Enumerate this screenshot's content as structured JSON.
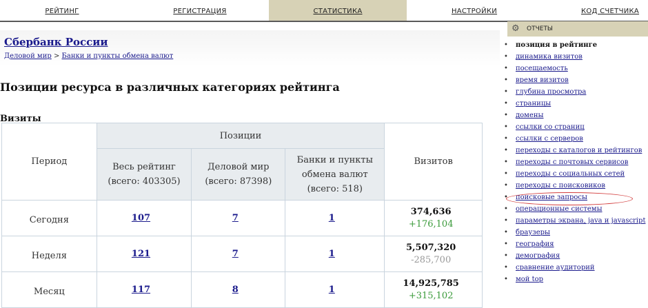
{
  "nav": {
    "tabs": [
      "РЕЙТИНГ",
      "РЕГИСТРАЦИЯ",
      "СТАТИСТИКА",
      "НАСТРОЙКИ",
      "КОД СЧЕТЧИКА"
    ],
    "active": "СТАТИСТИКА"
  },
  "site": {
    "title": "Сбербанк России",
    "breadcrumb": [
      "Деловой мир",
      "Банки и пункты обмена валют"
    ],
    "breadcrumb_sep": " > "
  },
  "page": {
    "heading": "Позиции ресурса в различных категориях рейтинга",
    "section": "Визиты"
  },
  "table": {
    "headers": {
      "period": "Период",
      "positions": "Позиции",
      "all_rating": "Весь рейтинг",
      "all_rating_total": "(всего: 403305)",
      "business": "Деловой мир",
      "business_total": "(всего: 87398)",
      "banks": "Банки и пункты обмена валют",
      "banks_total": "(всего: 518)",
      "visits": "Визитов"
    },
    "rows": [
      {
        "period": "Сегодня",
        "all": "107",
        "business": "7",
        "banks": "1",
        "visits": "374,636",
        "delta": "+176,104",
        "delta_sign": "pos"
      },
      {
        "period": "Неделя",
        "all": "121",
        "business": "7",
        "banks": "1",
        "visits": "5,507,320",
        "delta": "-285,700",
        "delta_sign": "neg"
      },
      {
        "period": "Месяц",
        "all": "117",
        "business": "8",
        "banks": "1",
        "visits": "14,925,785",
        "delta": "+315,102",
        "delta_sign": "pos"
      }
    ]
  },
  "panel": {
    "title": "ОТЧЕТЫ",
    "icon": "gear-icon",
    "highlight_color": "#d23c3c",
    "items": [
      "позиция в рейтинге",
      "динамика визитов",
      "посещаемость",
      "время визитов",
      "глубина просмотра",
      "страницы",
      "домены",
      "ссылки со страниц",
      "ссылки с серверов",
      "переходы с каталогов и рейтингов",
      "переходы с почтовых сервисов",
      "переходы с социальных сетей",
      "переходы с поисковиков",
      "поисковые запросы",
      "операционные системы",
      "параметры экрана, java и javascript",
      "браузеры",
      "география",
      "демография",
      "сравнение аудиторий",
      "мой top"
    ],
    "current_index": 0,
    "highlight_index": 13
  }
}
